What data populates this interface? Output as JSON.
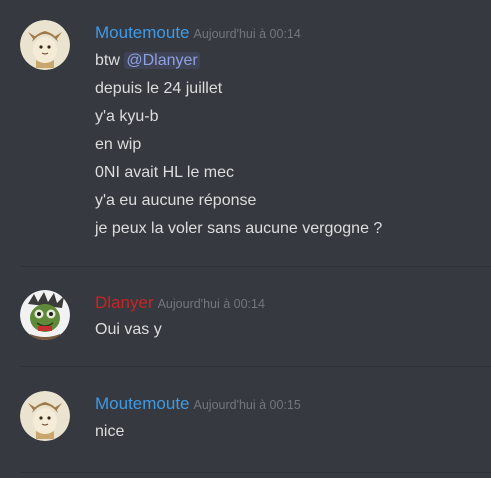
{
  "messages": [
    {
      "author": "Moutemoute",
      "author_color": "#3f9ae6",
      "timestamp": "Aujourd'hui à 00:14",
      "lines": {
        "l0_prefix": "btw ",
        "l0_mention": "@Dlanyer",
        "l1": "depuis le 24 juillet",
        "l2": "y'a kyu-b",
        "l3": "en wip",
        "l4": "0NI avait HL le mec",
        "l5": "y'a eu aucune réponse",
        "l6": "je peux la voler sans aucune vergogne ?"
      }
    },
    {
      "author": "Dlanyer",
      "author_color": "#c72525",
      "timestamp": "Aujourd'hui à 00:14",
      "lines": {
        "l0": "Oui vas y"
      }
    },
    {
      "author": "Moutemoute",
      "author_color": "#3f9ae6",
      "timestamp": "Aujourd'hui à 00:15",
      "lines": {
        "l0": "nice"
      }
    }
  ],
  "icons": {
    "avatar_moutemoute": "chibi-character-avatar",
    "avatar_dlanyer": "green-creature-avatar"
  },
  "colors": {
    "background": "#36393f",
    "text": "#dcddde",
    "timestamp": "#72767d",
    "mention": "#8ea1e1"
  }
}
